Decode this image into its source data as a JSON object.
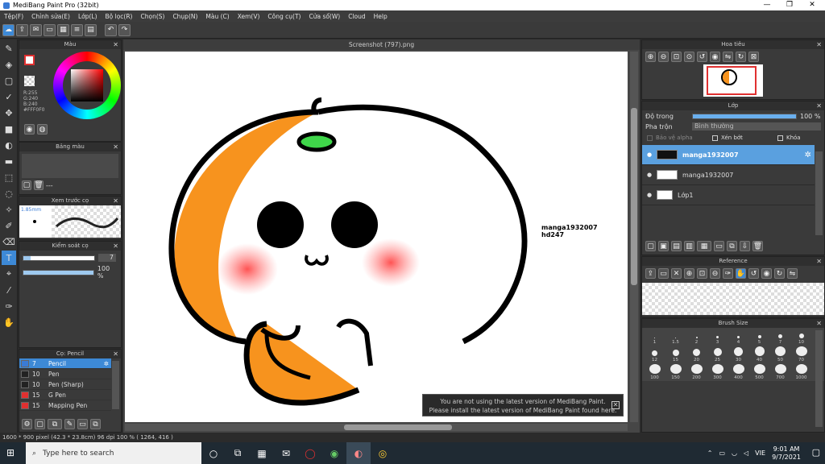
{
  "app": {
    "title": "MediBang Paint Pro (32bit)"
  },
  "menu": [
    "Tệp(F)",
    "Chỉnh sửa(E)",
    "Lớp(L)",
    "Bộ lọc(R)",
    "Chọn(S)",
    "Chụp(N)",
    "Màu (C)",
    "Xem(V)",
    "Công cụ(T)",
    "Cửa sổ(W)",
    "Cloud",
    "Help"
  ],
  "panels": {
    "color": {
      "title": "Màu",
      "r": "R:255",
      "g": "G:240",
      "b": "B:240",
      "hex": "#FFF0F0"
    },
    "palette": {
      "title": "Bảng màu",
      "label": "---"
    },
    "preview": {
      "title": "Xem trước cọ",
      "size": "1.85mm"
    },
    "brushctrl": {
      "title": "Kiểm soát cọ",
      "size": "7",
      "opacity": "100 %"
    },
    "brushes": {
      "title": "Cọ: Pencil",
      "items": [
        {
          "size": "7",
          "name": "Pencil",
          "color": "#3a7bd5"
        },
        {
          "size": "10",
          "name": "Pen",
          "color": "#222"
        },
        {
          "size": "10",
          "name": "Pen (Sharp)",
          "color": "#222"
        },
        {
          "size": "15",
          "name": "G Pen",
          "color": "#e03030"
        },
        {
          "size": "15",
          "name": "Mapping Pen",
          "color": "#e03030"
        }
      ]
    },
    "navigator": {
      "title": "Hoa tiêu"
    },
    "layers": {
      "title": "Lớp",
      "opacity_label": "Độ trong",
      "opacity_value": "100 %",
      "blend_label": "Pha trộn",
      "blend_value": "Bình thường",
      "alpha": "Bảo vệ alpha",
      "clip": "Xén bớt",
      "lock": "Khóa",
      "items": [
        {
          "name": "manga1932007"
        },
        {
          "name": "manga1932007"
        },
        {
          "name": "Lớp1"
        }
      ]
    },
    "reference": {
      "title": "Reference"
    },
    "brushsize": {
      "title": "Brush Size",
      "row1": [
        "1",
        "1.5",
        "2",
        "3",
        "4",
        "5",
        "7",
        "10"
      ],
      "row2": [
        "12",
        "15",
        "20",
        "25",
        "30",
        "40",
        "50",
        "70"
      ],
      "row3": [
        "100",
        "150",
        "200",
        "300",
        "400",
        "500",
        "700",
        "1000"
      ]
    }
  },
  "document": {
    "tab": "Screenshot (797).png",
    "watermark1": "manga1932007",
    "watermark2": "hd247"
  },
  "notice": {
    "line1": "You are not using the latest version of MediBang Paint.",
    "line2": "Please install the latest version of MediBang Paint found here."
  },
  "status": {
    "text": "1600 * 900 pixel  (42.3 * 23.8cm)  96 dpi  100 %  ( 1264, 416 )"
  },
  "taskbar": {
    "search": "Type here to search",
    "time": "9:01 AM",
    "date": "9/7/2021",
    "lang": "VIE"
  },
  "colors": {
    "accent": "#3d89d6",
    "orange": "#f7931e"
  }
}
